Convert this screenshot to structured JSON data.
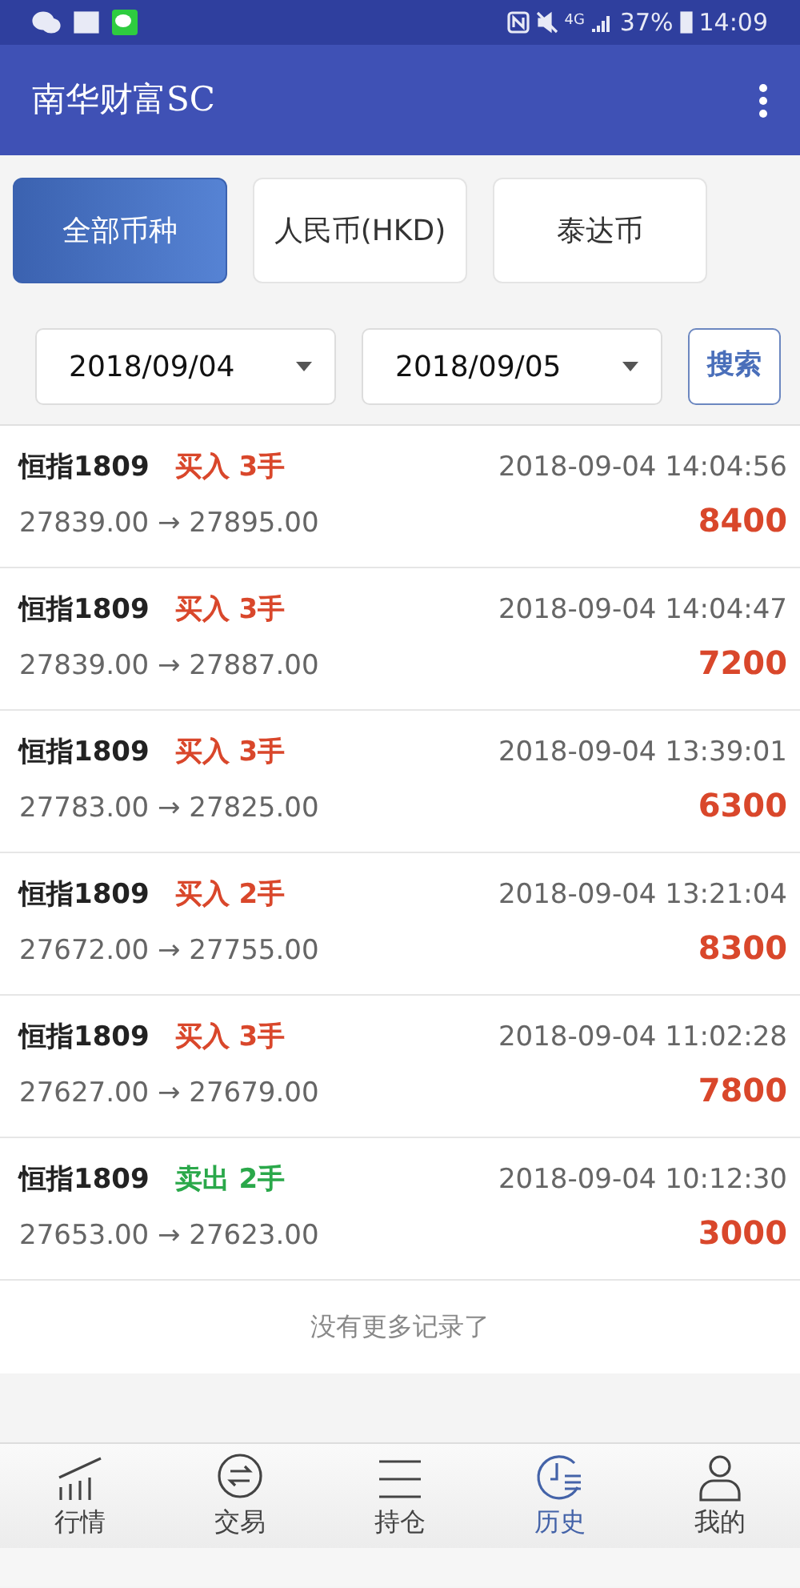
{
  "status_bar": {
    "network": "4G",
    "battery": "37%",
    "time": "14:09"
  },
  "app_bar": {
    "title": "南华财富SC"
  },
  "currency_tabs": [
    {
      "label": "全部币种",
      "selected": true
    },
    {
      "label": "人民币(HKD)",
      "selected": false
    },
    {
      "label": "泰达币",
      "selected": false
    }
  ],
  "filters": {
    "start_date": "2018/09/04",
    "end_date": "2018/09/05",
    "search_button": "搜索"
  },
  "trades": [
    {
      "symbol": "恒指1809",
      "kind": "buy",
      "action": "买入 3手",
      "time": "2018-09-04 14:04:56",
      "prices": "27839.00 → 27895.00",
      "amount": "8400"
    },
    {
      "symbol": "恒指1809",
      "kind": "buy",
      "action": "买入 3手",
      "time": "2018-09-04 14:04:47",
      "prices": "27839.00 → 27887.00",
      "amount": "7200"
    },
    {
      "symbol": "恒指1809",
      "kind": "buy",
      "action": "买入 3手",
      "time": "2018-09-04 13:39:01",
      "prices": "27783.00 → 27825.00",
      "amount": "6300"
    },
    {
      "symbol": "恒指1809",
      "kind": "buy",
      "action": "买入 2手",
      "time": "2018-09-04 13:21:04",
      "prices": "27672.00 → 27755.00",
      "amount": "8300"
    },
    {
      "symbol": "恒指1809",
      "kind": "buy",
      "action": "买入 3手",
      "time": "2018-09-04 11:02:28",
      "prices": "27627.00 → 27679.00",
      "amount": "7800"
    },
    {
      "symbol": "恒指1809",
      "kind": "sell",
      "action": "卖出 2手",
      "time": "2018-09-04 10:12:30",
      "prices": "27653.00 → 27623.00",
      "amount": "3000"
    }
  ],
  "end_note": "没有更多记录了",
  "bottom_nav": [
    {
      "label": "行情",
      "kind": "chart",
      "selected": false
    },
    {
      "label": "交易",
      "kind": "exchange",
      "selected": false
    },
    {
      "label": "持仓",
      "kind": "lines",
      "selected": false
    },
    {
      "label": "历史",
      "kind": "history",
      "selected": true
    },
    {
      "label": "我的",
      "kind": "person",
      "selected": false
    }
  ]
}
